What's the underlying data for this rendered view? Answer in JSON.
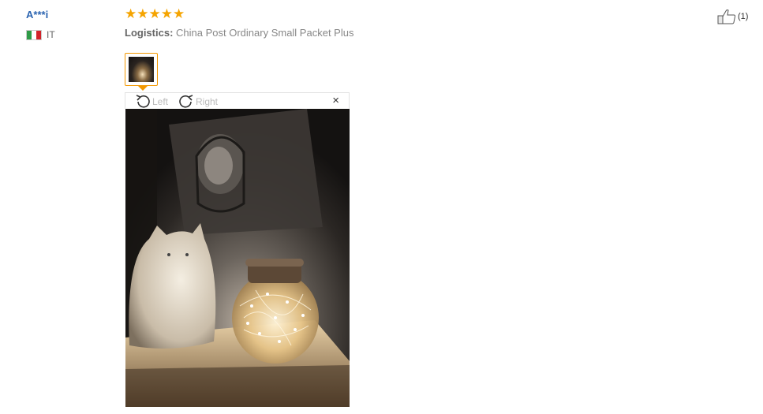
{
  "review": {
    "user_name": "A***i",
    "country": "IT",
    "rating": "★★★★★",
    "logistics_label": "Logistics:",
    "logistics_value": "China Post Ordinary Small Packet Plus",
    "like_count": "(1)"
  },
  "viewer": {
    "rotate_left": "Left",
    "rotate_right": "Right",
    "close": "×"
  },
  "colors": {
    "user_name": "#2a63b0",
    "stars": "#f5a400",
    "thumb_border": "#f39800"
  },
  "icons": [
    "like-thumb-icon",
    "rotate-left-icon",
    "rotate-right-icon",
    "close-icon",
    "italy-flag-icon"
  ]
}
